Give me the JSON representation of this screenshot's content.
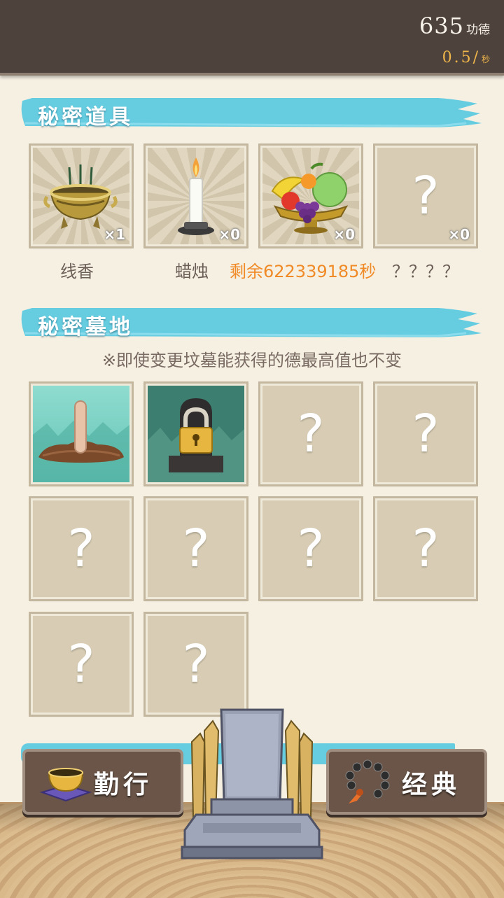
{
  "header": {
    "merit_value": "635",
    "merit_unit": "功德",
    "rate_value": "0.5/",
    "rate_unit": "秒"
  },
  "items_section": {
    "title": "秘密道具",
    "slots": [
      {
        "icon": "incense-burner-icon",
        "count": "×1",
        "label": "线香"
      },
      {
        "icon": "candle-icon",
        "count": "×0",
        "label": "蜡烛"
      },
      {
        "icon": "fruit-bowl-icon",
        "count": "×0",
        "label": "剩余622339185秒"
      },
      {
        "icon": "question-mark",
        "glyph": "?",
        "count": "×0",
        "label": "？？？？"
      }
    ]
  },
  "graves_section": {
    "title": "秘密墓地",
    "note": "※即使变更坟墓能获得的德最高值也不变",
    "slots": [
      {
        "icon": "grave-marker-icon"
      },
      {
        "icon": "padlock-icon"
      },
      {
        "glyph": "?"
      },
      {
        "glyph": "?"
      },
      {
        "glyph": "?"
      },
      {
        "glyph": "?"
      },
      {
        "glyph": "?"
      },
      {
        "glyph": "?"
      },
      {
        "glyph": "?"
      },
      {
        "glyph": "?"
      }
    ]
  },
  "bottom_nav": {
    "left_label": "勤行",
    "right_label": "经典",
    "center_icon": "gravestone-icon"
  },
  "colors": {
    "topbar": "#4e433c",
    "rate_text": "#f0b64a",
    "banner": "#66cde1",
    "timer_text": "#f08a26",
    "slot": "#d8cdb4"
  }
}
